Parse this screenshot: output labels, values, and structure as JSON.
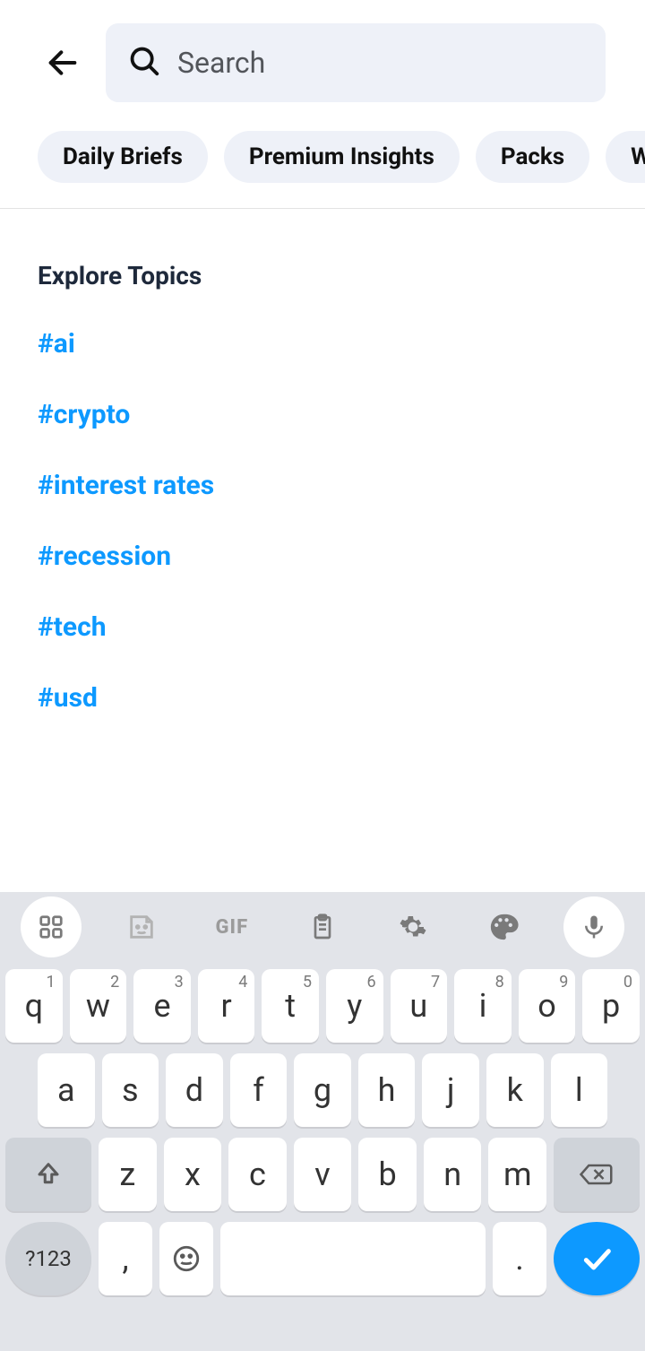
{
  "header": {
    "search_placeholder": "Search"
  },
  "chips": [
    "Daily Briefs",
    "Premium Insights",
    "Packs",
    "Weekly I"
  ],
  "topics": {
    "title": "Explore Topics",
    "items": [
      "#ai",
      "#crypto",
      "#interest rates",
      "#recession",
      "#tech",
      "#usd"
    ]
  },
  "keyboard": {
    "row1": [
      {
        "k": "q",
        "s": "1"
      },
      {
        "k": "w",
        "s": "2"
      },
      {
        "k": "e",
        "s": "3"
      },
      {
        "k": "r",
        "s": "4"
      },
      {
        "k": "t",
        "s": "5"
      },
      {
        "k": "y",
        "s": "6"
      },
      {
        "k": "u",
        "s": "7"
      },
      {
        "k": "i",
        "s": "8"
      },
      {
        "k": "o",
        "s": "9"
      },
      {
        "k": "p",
        "s": "0"
      }
    ],
    "row2": [
      "a",
      "s",
      "d",
      "f",
      "g",
      "h",
      "j",
      "k",
      "l"
    ],
    "row3": [
      "z",
      "x",
      "c",
      "v",
      "b",
      "n",
      "m"
    ],
    "sym_label": "?123",
    "comma": ",",
    "period": "."
  }
}
